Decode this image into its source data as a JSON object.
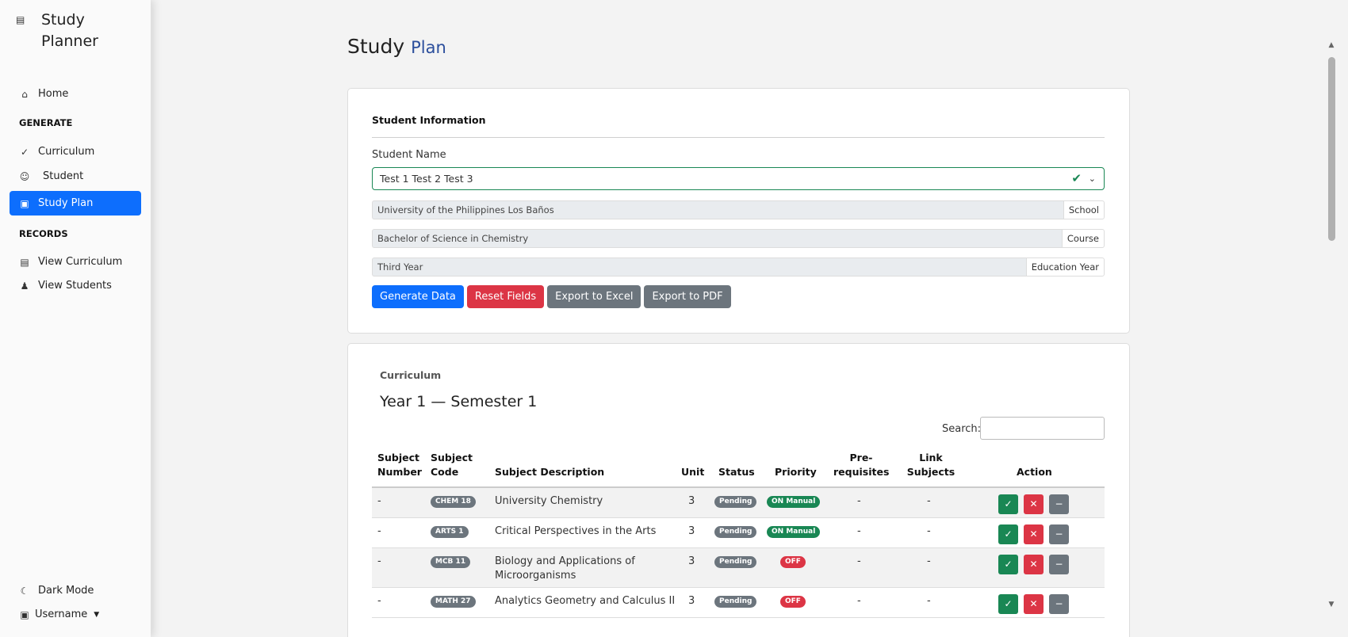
{
  "app": {
    "brand_title": "Study Planner",
    "accent_color": "#0d6efd"
  },
  "sidebar": {
    "home": "Home",
    "generate_heading": "GENERATE",
    "curriculum": "Curriculum",
    "student": "Student",
    "study_plan": "Study Plan",
    "records_heading": "RECORDS",
    "view_curriculum": "View Curriculum",
    "view_students": "View Students",
    "dark_mode": "Dark Mode",
    "username": "Username"
  },
  "page": {
    "title": "Study",
    "title_sub": "Plan"
  },
  "student_info": {
    "section_title": "Student Information",
    "name_label": "Student Name",
    "selected_student": "Test 1 Test 2 Test 3",
    "school_value": "University of the Philippines Los Baños",
    "school_tag": "School",
    "course_value": "Bachelor of Science in Chemistry",
    "course_tag": "Course",
    "year_value": "Third Year",
    "year_tag": "Education Year"
  },
  "buttons": {
    "generate": "Generate Data",
    "reset": "Reset Fields",
    "excel": "Export to Excel",
    "pdf": "Export to PDF"
  },
  "curriculum": {
    "label": "Curriculum",
    "year_title": "Year 1 — Semester 1",
    "search_label": "Search:",
    "headers": {
      "number_1": "Subject",
      "number_2": "Number",
      "code_1": "Subject",
      "code_2": "Code",
      "description": "Subject Description",
      "unit": "Unit",
      "status": "Status",
      "priority": "Priority",
      "prereq_1": "Pre-",
      "prereq_2": "requisites",
      "link_1": "Link",
      "link_2": "Subjects",
      "action": "Action"
    },
    "rows": [
      {
        "number": "-",
        "code": "CHEM 18",
        "description": "University Chemistry",
        "unit": "3",
        "status": "Pending",
        "priority": "ON Manual",
        "prereq": "-",
        "link": "-"
      },
      {
        "number": "-",
        "code": "ARTS 1",
        "description": "Critical Perspectives in the Arts",
        "unit": "3",
        "status": "Pending",
        "priority": "ON Manual",
        "prereq": "-",
        "link": "-"
      },
      {
        "number": "-",
        "code": "MCB 11",
        "description": "Biology and Applications of Microorganisms",
        "unit": "3",
        "status": "Pending",
        "priority": "OFF",
        "prereq": "-",
        "link": "-"
      },
      {
        "number": "-",
        "code": "MATH 27",
        "description": "Analytics Geometry and Calculus II",
        "unit": "3",
        "status": "Pending",
        "priority": "OFF",
        "prereq": "-",
        "link": "-"
      }
    ]
  }
}
